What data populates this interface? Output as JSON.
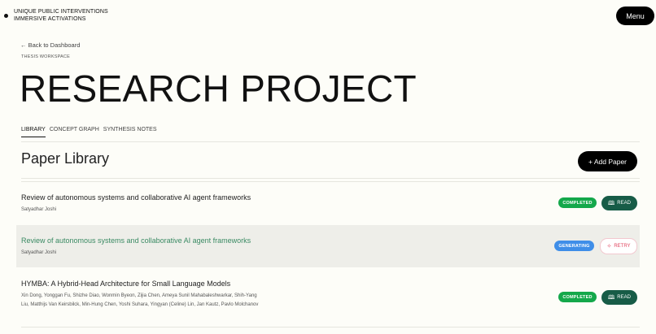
{
  "brand": {
    "line1": "UNIQUE PUBLIC INTERVENTIONS",
    "line2": "IMMERSIVE ACTIVATIONS"
  },
  "menu_label": "Menu",
  "nav": {
    "back_label": "← Back to Dashboard",
    "workspace_label": "THESIS WORKSPACE"
  },
  "project": {
    "title": "RESEARCH PROJECT"
  },
  "tabs": [
    {
      "label": "LIBRARY",
      "active": true
    },
    {
      "label": "CONCEPT GRAPH",
      "active": false
    },
    {
      "label": "SYNTHESIS NOTES",
      "active": false
    }
  ],
  "library": {
    "title": "Paper Library",
    "add_label": "+ Add Paper",
    "papers": [
      {
        "title": "Review of autonomous systems and collaborative AI agent frameworks",
        "authors": "Satyadhar Joshi",
        "status": "COMPLETED",
        "action": "READ"
      },
      {
        "title": "Review of autonomous systems and collaborative AI agent frameworks",
        "authors": "Satyadhar Joshi",
        "status": "GENERATING",
        "action": "RETRY"
      },
      {
        "title": "HYMBA: A Hybrid-Head Architecture for Small Language Models",
        "authors": "Xin Dong, Yonggan Fu, Shizhe Diao, Wonmin Byeon, Zijia Chen, Ameya Sunil Mahabaleshwarkar, Shih-Yang Liu, Matthijs Van Keirsbilck, Min-Hung Chen, Yoshi Suhara, Yingyan (Celine) Lin, Jan Kautz, Pavlo Molchanov",
        "status": "COMPLETED",
        "action": "READ"
      }
    ]
  },
  "colors": {
    "completed": "#14a84b",
    "generating": "#3f8ee8",
    "read_button": "#175c47",
    "retry_text": "#e0455f",
    "link_title": "#3a8a63"
  },
  "icons": {
    "read": "book-icon",
    "retry": "retry-icon"
  }
}
